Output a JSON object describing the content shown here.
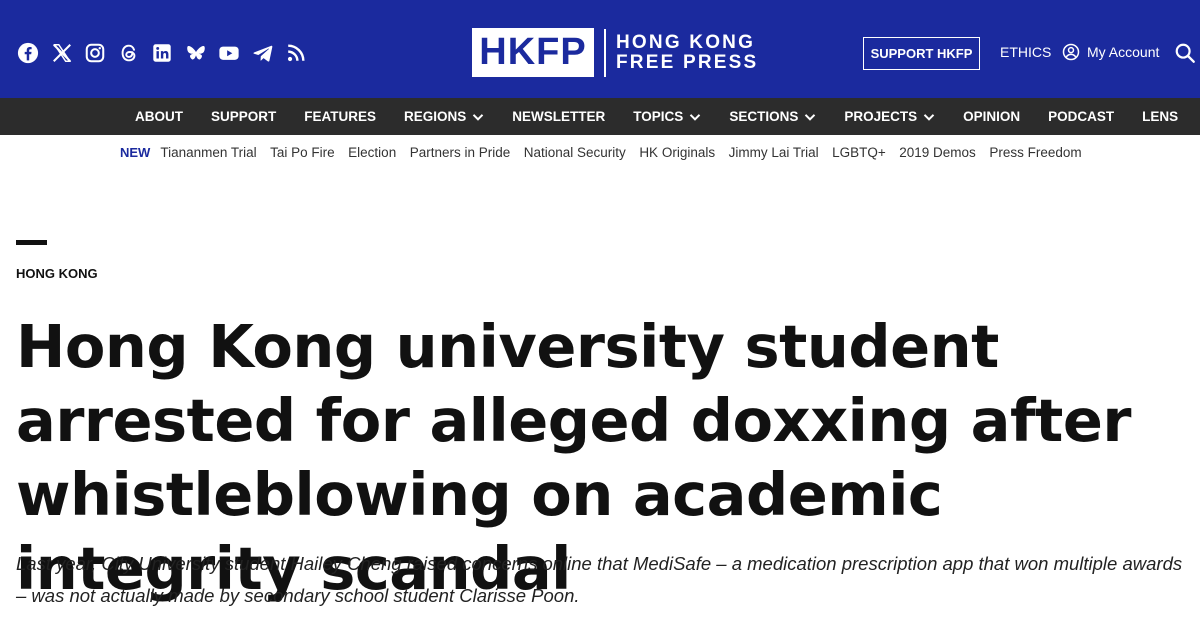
{
  "header": {
    "social_icons": [
      "facebook-icon",
      "x-icon",
      "instagram-icon",
      "threads-icon",
      "linkedin-icon",
      "bluesky-icon",
      "youtube-icon",
      "telegram-icon",
      "rss-icon"
    ],
    "logo_mark": "HKFP",
    "logo_line1": "HONG KONG",
    "logo_line2": "FREE PRESS",
    "support_label": "SUPPORT HKFP",
    "ethics_label": "ETHICS",
    "account_label": "My Account",
    "brand_color": "#1b2a9e"
  },
  "nav": {
    "items": [
      {
        "label": "ABOUT",
        "dropdown": false
      },
      {
        "label": "SUPPORT",
        "dropdown": false
      },
      {
        "label": "FEATURES",
        "dropdown": false
      },
      {
        "label": "REGIONS",
        "dropdown": true
      },
      {
        "label": "NEWSLETTER",
        "dropdown": false
      },
      {
        "label": "TOPICS",
        "dropdown": true
      },
      {
        "label": "SECTIONS",
        "dropdown": true
      },
      {
        "label": "PROJECTS",
        "dropdown": true
      },
      {
        "label": "OPINION",
        "dropdown": false
      },
      {
        "label": "PODCAST",
        "dropdown": false
      },
      {
        "label": "LENS",
        "dropdown": false
      }
    ]
  },
  "trending": {
    "new_label": "NEW",
    "links": [
      "Tiananmen Trial",
      "Tai Po Fire",
      "Election",
      "Partners in Pride",
      "National Security",
      "HK Originals",
      "Jimmy Lai Trial",
      "LGBTQ+",
      "2019 Demos",
      "Press Freedom"
    ]
  },
  "article": {
    "category": "HONG KONG",
    "title": "Hong Kong university student arrested for alleged doxxing after whistleblowing on academic integrity scandal",
    "dek": "Last year, City University student Hailey Cheng raised concerns online that MediSafe – a medication prescription app that won multiple awards – was not actually made by secondary school student Clarisse Poon."
  }
}
